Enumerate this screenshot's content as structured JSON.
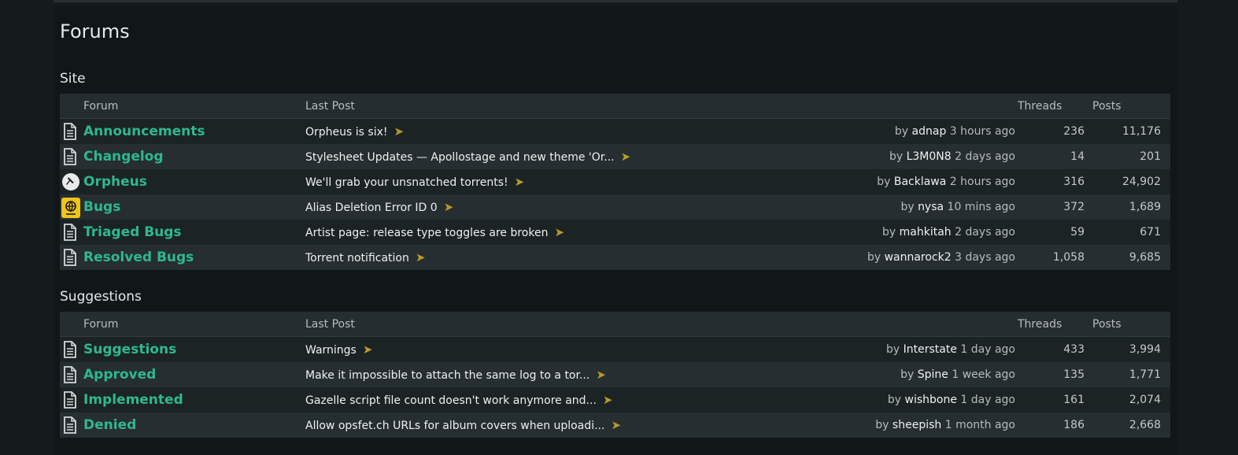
{
  "page_title": "Forums",
  "headers": {
    "forum": "Forum",
    "last_post": "Last Post",
    "threads": "Threads",
    "posts": "Posts"
  },
  "by_label": "by",
  "sections": [
    {
      "title": "Site",
      "rows": [
        {
          "icon": "document-icon",
          "name": "Announcements",
          "last_post": "Orpheus is six!",
          "user": "adnap",
          "time": "3 hours ago",
          "threads": "236",
          "posts": "11,176"
        },
        {
          "icon": "document-icon",
          "name": "Changelog",
          "last_post": "Stylesheet Updates — Apollostage and new theme 'Or...",
          "user": "L3M0N8",
          "time": "2 days ago",
          "threads": "14",
          "posts": "201"
        },
        {
          "icon": "pin-icon",
          "name": "Orpheus",
          "last_post": "We'll grab your unsnatched torrents!",
          "user": "Backlawa",
          "time": "2 hours ago",
          "threads": "316",
          "posts": "24,902"
        },
        {
          "icon": "globe-badge-icon",
          "name": "Bugs",
          "last_post": "Alias Deletion Error ID 0",
          "user": "nysa",
          "time": "10 mins ago",
          "threads": "372",
          "posts": "1,689"
        },
        {
          "icon": "document-icon",
          "name": "Triaged Bugs",
          "last_post": "Artist page: release type toggles are broken",
          "user": "mahkitah",
          "time": "2 days ago",
          "threads": "59",
          "posts": "671"
        },
        {
          "icon": "document-icon",
          "name": "Resolved Bugs",
          "last_post": "Torrent notification",
          "user": "wannarock2",
          "time": "3 days ago",
          "threads": "1,058",
          "posts": "9,685"
        }
      ]
    },
    {
      "title": "Suggestions",
      "rows": [
        {
          "icon": "document-icon",
          "name": "Suggestions",
          "last_post": "Warnings",
          "user": "Interstate",
          "time": "1 day ago",
          "threads": "433",
          "posts": "3,994"
        },
        {
          "icon": "document-icon",
          "name": "Approved",
          "last_post": "Make it impossible to attach the same log to a tor...",
          "user": "Spine",
          "time": "1 week ago",
          "threads": "135",
          "posts": "1,771"
        },
        {
          "icon": "document-icon",
          "name": "Implemented",
          "last_post": "Gazelle script file count doesn't work anymore and...",
          "user": "wishbone",
          "time": "1 day ago",
          "threads": "161",
          "posts": "2,074"
        },
        {
          "icon": "document-icon",
          "name": "Denied",
          "last_post": "Allow opsfet.ch URLs for album covers when uploadi...",
          "user": "sheepish",
          "time": "1 month ago",
          "threads": "186",
          "posts": "2,668"
        }
      ]
    }
  ]
}
